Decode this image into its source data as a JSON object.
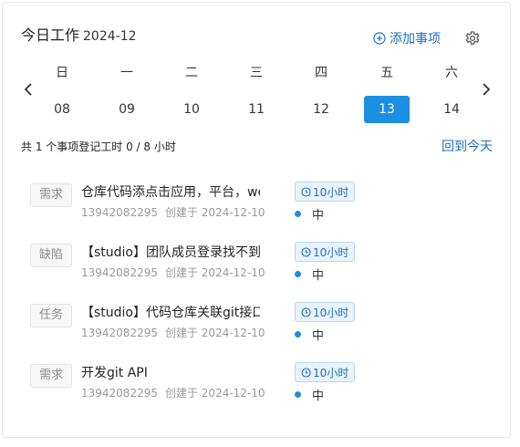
{
  "header": {
    "title": "今日工作",
    "period": "2024-12",
    "add_label": "添加事项"
  },
  "week": [
    {
      "weekday": "日",
      "date": "08",
      "active": false
    },
    {
      "weekday": "一",
      "date": "09",
      "active": false
    },
    {
      "weekday": "二",
      "date": "10",
      "active": false
    },
    {
      "weekday": "三",
      "date": "11",
      "active": false
    },
    {
      "weekday": "四",
      "date": "12",
      "active": false
    },
    {
      "weekday": "五",
      "date": "13",
      "active": true
    },
    {
      "weekday": "六",
      "date": "14",
      "active": false
    }
  ],
  "summary": {
    "text": "共 1 个事项登记工时 0 / 8 小时",
    "back_today": "回到今天"
  },
  "tasks": [
    {
      "type": "需求",
      "title": "仓库代码添点击应用，平台，we",
      "user": "13942082295",
      "created": "创建于 2024-12-10",
      "hours": "10小时",
      "priority": "中"
    },
    {
      "type": "缺陷",
      "title": "【studio】团队成员登录找不到!",
      "user": "13942082295",
      "created": "创建于 2024-12-10",
      "hours": "10小时",
      "priority": "中"
    },
    {
      "type": "任务",
      "title": "【studio】代码仓库关联git接口",
      "user": "13942082295",
      "created": "创建于 2024-12-10",
      "hours": "10小时",
      "priority": "中"
    },
    {
      "type": "需求",
      "title": "开发git API",
      "user": "13942082295",
      "created": "创建于 2024-12-10",
      "hours": "10小时",
      "priority": "中"
    }
  ],
  "colors": {
    "accent": "#1d8fe3",
    "link": "#1d6fc0",
    "tag_bg": "#f7f7f7",
    "hours_bg": "#e8f3fd"
  },
  "icons": {
    "add": "plus-circle-icon",
    "settings": "gear-icon",
    "prev": "chevron-left-icon",
    "next": "chevron-right-icon",
    "hours": "clock-icon"
  }
}
